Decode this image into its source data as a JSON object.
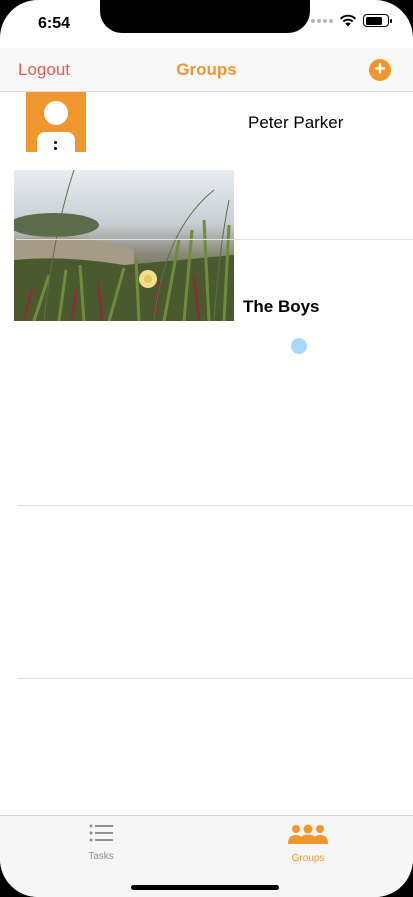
{
  "status_bar": {
    "time": "6:54"
  },
  "navbar": {
    "left_label": "Logout",
    "title": "Groups",
    "add_symbol": "+"
  },
  "rows": [
    {
      "name": "Peter Parker",
      "icon": "person-avatar-icon"
    },
    {
      "name": "The Boys",
      "image": "flower-grass-photo"
    }
  ],
  "tabbar": {
    "tabs": [
      {
        "label": "Tasks",
        "icon": "list-icon",
        "active": false
      },
      {
        "label": "Groups",
        "icon": "people-icon",
        "active": true
      }
    ]
  },
  "colors": {
    "accent": "#f0962e",
    "logout": "#e0604a",
    "inactive": "#8e8e93"
  }
}
